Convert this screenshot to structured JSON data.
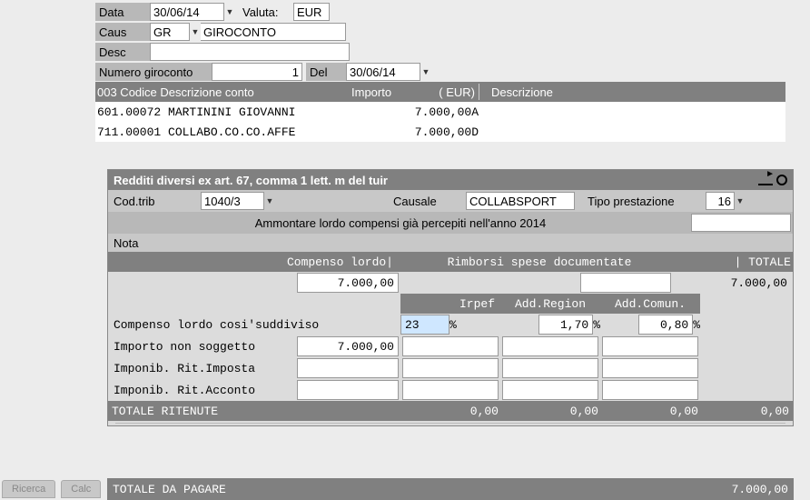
{
  "top": {
    "data_label": "Data",
    "data_value": "30/06/14",
    "valuta_label": "Valuta:",
    "valuta_value": "EUR",
    "caus_label": "Caus",
    "caus_code": "GR",
    "caus_desc": "GIROCONTO",
    "desc_label": "Desc",
    "desc_value": "",
    "num_giro_label": "Numero giroconto",
    "num_giro_value": "1",
    "del_label": "Del",
    "del_value": "30/06/14"
  },
  "grid": {
    "header_codice": "003   Codice Descrizione conto",
    "header_importo": "Importo",
    "header_currency": "( EUR)",
    "header_descrizione": "Descrizione",
    "rows": [
      {
        "codice": "601.00072 MARTININI GIOVANNI",
        "importo": "7.000,00A"
      },
      {
        "codice": "711.00001 COLLABO.CO.CO.AFFE",
        "importo": "7.000,00D"
      }
    ]
  },
  "panel": {
    "title": "Redditi diversi ex art. 67, comma 1 lett. m del tuir",
    "codtrib_label": "Cod.trib",
    "codtrib_value": "1040/3",
    "causale_label": "Causale",
    "causale_value": "COLLABSPORT",
    "tipoprest_label": "Tipo prestazione",
    "tipoprest_value": "16",
    "ammontare_label": "Ammontare lordo compensi già percepiti nell'anno 2014",
    "ammontare_value": "",
    "nota_label": "Nota",
    "hdr_compenso": "Compenso lordo|",
    "hdr_rimborsi": "Rimborsi spese documentate",
    "hdr_totale": "|   TOTALE",
    "compenso_value": "7.000,00",
    "rimborsi_value": "",
    "totale_value": "7.000,00",
    "hdr_irpef": "Irpef",
    "hdr_addreg": "Add.Region",
    "hdr_addcom": "Add.Comun.",
    "suddiviso_label": "Compenso lordo cosi'suddiviso",
    "irpef_pct": "23",
    "addreg_pct": "1,70",
    "addcom_pct": "0,80",
    "pct_sign": "%",
    "importo_non_sogg_label": "Importo non soggetto",
    "importo_non_sogg_value": "7.000,00",
    "imponib_imposta_label": "Imponib. Rit.Imposta",
    "imponib_imposta_value": "",
    "imponib_acconto_label": "Imponib. Rit.Acconto",
    "imponib_acconto_value": "",
    "totale_ritenute_label": "TOTALE RITENUTE",
    "totale_ritenute_irpef": "0,00",
    "totale_ritenute_reg": "0,00",
    "totale_ritenute_com": "0,00",
    "totale_ritenute_tot": "0,00",
    "totale_pagare_label": "TOTALE DA PAGARE",
    "totale_pagare_value": "7.000,00"
  },
  "tabs": {
    "ricerca": "Ricerca",
    "calc": "Calc"
  }
}
